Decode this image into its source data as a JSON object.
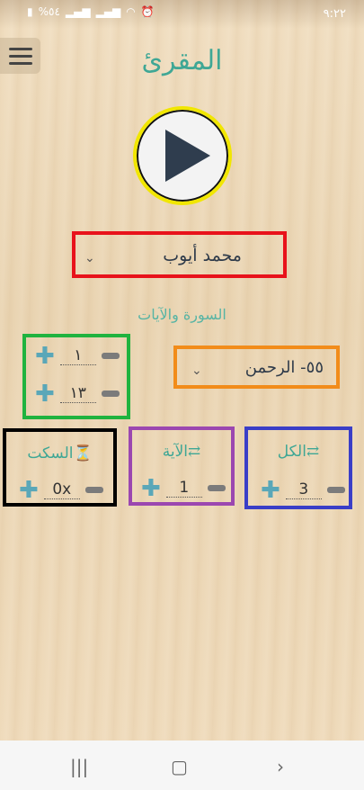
{
  "status_bar": {
    "time": "٩:٢٢",
    "battery": "%٥٤"
  },
  "app": {
    "title": "المقرئ"
  },
  "reciter": {
    "name": "محمد أيوب"
  },
  "section_label": "السورة والآيات",
  "ayah_range": {
    "from": "١",
    "to": "١٣"
  },
  "surah": {
    "name": "٥٥- الرحمن"
  },
  "silence": {
    "label": "السكت",
    "value": "0x"
  },
  "ayah_repeat": {
    "label": "الآية",
    "value": "1"
  },
  "all_repeat": {
    "label": "الكل",
    "value": "3"
  },
  "icons": {
    "menu": "hamburger-icon",
    "play": "play-icon",
    "dropdown": "chevron-down-icon",
    "increase": "plus-icon",
    "decrease": "minus-icon",
    "timer": "hourglass-icon",
    "repeat": "repeat-icon"
  },
  "colors": {
    "accent": "#3fa795",
    "reciter_frame": "#e8121b",
    "ayah_frame": "#1fb33f",
    "surah_frame": "#f28c1a",
    "silence_frame": "#000000",
    "ayah_repeat_frame": "#9b47b0",
    "all_repeat_frame": "#3a3ec7"
  }
}
